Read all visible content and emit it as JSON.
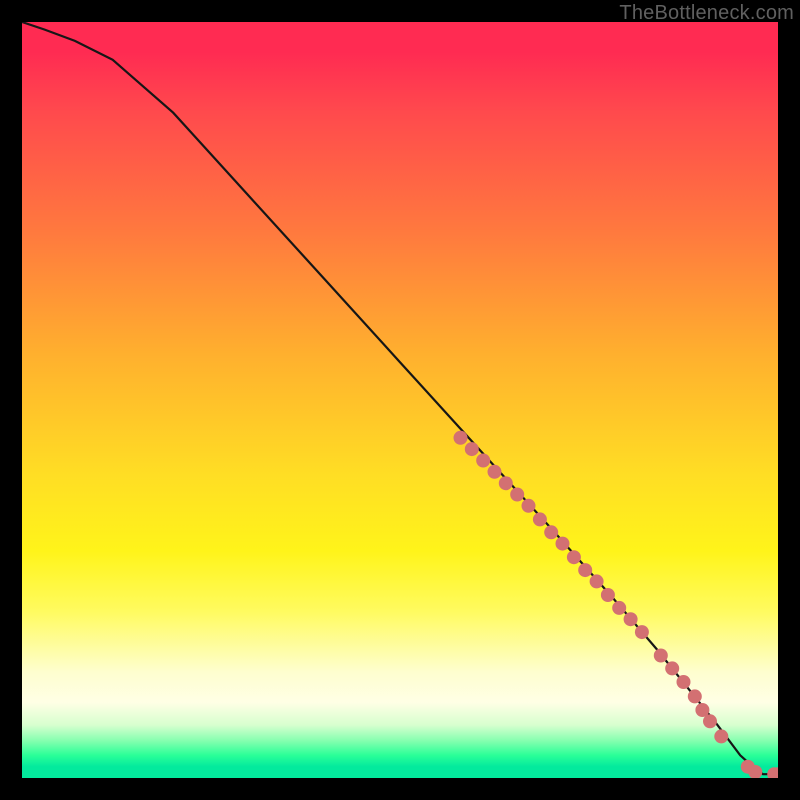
{
  "watermark": "TheBottleneck.com",
  "chart_data": {
    "type": "line",
    "title": "",
    "xlabel": "",
    "ylabel": "",
    "xlim": [
      0,
      100
    ],
    "ylim": [
      0,
      100
    ],
    "series": [
      {
        "name": "curve",
        "x": [
          0,
          3,
          7,
          12,
          20,
          30,
          40,
          50,
          60,
          70,
          78,
          84,
          88,
          92,
          95,
          97,
          98,
          100
        ],
        "y": [
          100,
          99,
          97.5,
          95,
          88,
          77,
          66,
          55,
          44,
          33,
          24,
          17,
          12,
          7,
          3,
          1.2,
          0.5,
          0.5
        ]
      }
    ],
    "points": [
      {
        "x": 58,
        "y": 45
      },
      {
        "x": 59.5,
        "y": 43.5
      },
      {
        "x": 61,
        "y": 42
      },
      {
        "x": 62.5,
        "y": 40.5
      },
      {
        "x": 64,
        "y": 39
      },
      {
        "x": 65.5,
        "y": 37.5
      },
      {
        "x": 67,
        "y": 36
      },
      {
        "x": 68.5,
        "y": 34.2
      },
      {
        "x": 70,
        "y": 32.5
      },
      {
        "x": 71.5,
        "y": 31
      },
      {
        "x": 73,
        "y": 29.2
      },
      {
        "x": 74.5,
        "y": 27.5
      },
      {
        "x": 76,
        "y": 26
      },
      {
        "x": 77.5,
        "y": 24.2
      },
      {
        "x": 79,
        "y": 22.5
      },
      {
        "x": 80.5,
        "y": 21
      },
      {
        "x": 82,
        "y": 19.3
      },
      {
        "x": 84.5,
        "y": 16.2
      },
      {
        "x": 86,
        "y": 14.5
      },
      {
        "x": 87.5,
        "y": 12.7
      },
      {
        "x": 89,
        "y": 10.8
      },
      {
        "x": 90,
        "y": 9
      },
      {
        "x": 91,
        "y": 7.5
      },
      {
        "x": 92.5,
        "y": 5.5
      },
      {
        "x": 96,
        "y": 1.5
      },
      {
        "x": 97,
        "y": 0.8
      },
      {
        "x": 99.5,
        "y": 0.5
      },
      {
        "x": 100,
        "y": 0.5
      }
    ]
  }
}
